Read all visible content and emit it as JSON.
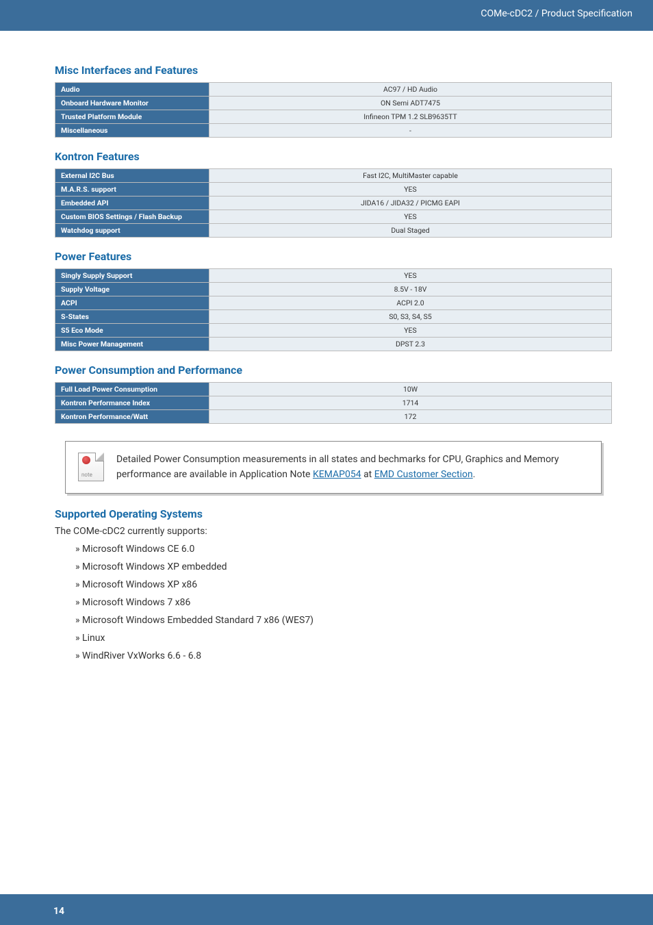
{
  "header": {
    "doc_title": "COMe-cDC2 / Product Specification"
  },
  "sections": {
    "misc": {
      "title": "Misc Interfaces and Features",
      "rows": [
        {
          "label": "Audio",
          "value": "AC97 / HD Audio"
        },
        {
          "label": "Onboard Hardware Monitor",
          "value": "ON Semi ADT7475"
        },
        {
          "label": "Trusted Platform Module",
          "value": "Infineon TPM 1.2 SLB9635TT"
        },
        {
          "label": "Miscellaneous",
          "value": "-"
        }
      ]
    },
    "kontron": {
      "title": "Kontron Features",
      "rows": [
        {
          "label": "External I2C Bus",
          "value": "Fast I2C, MultiMaster capable"
        },
        {
          "label": "M.A.R.S. support",
          "value": "YES"
        },
        {
          "label": "Embedded API",
          "value": "JIDA16 / JIDA32 / PICMG EAPI"
        },
        {
          "label": "Custom BIOS Settings / Flash Backup",
          "value": "YES"
        },
        {
          "label": "Watchdog support",
          "value": "Dual Staged"
        }
      ]
    },
    "power_features": {
      "title": "Power Features",
      "rows": [
        {
          "label": "Singly Supply Support",
          "value": "YES"
        },
        {
          "label": "Supply Voltage",
          "value": "8.5V - 18V"
        },
        {
          "label": "ACPI",
          "value": "ACPI 2.0"
        },
        {
          "label": "S-States",
          "value": "S0, S3, S4, S5"
        },
        {
          "label": "S5 Eco Mode",
          "value": "YES"
        },
        {
          "label": "Misc Power Management",
          "value": "DPST 2.3"
        }
      ]
    },
    "power_consumption": {
      "title": "Power Consumption and Performance",
      "rows": [
        {
          "label": "Full Load Power Consumption",
          "value": "10W"
        },
        {
          "label": "Kontron Performance Index",
          "value": "1714"
        },
        {
          "label": "Kontron Performance/Watt",
          "value": "172"
        }
      ]
    },
    "supported_os": {
      "title": "Supported Operating Systems",
      "intro": "The COMe-cDC2 currently supports:",
      "items": [
        "Microsoft Windows CE 6.0",
        "Microsoft Windows XP embedded",
        "Microsoft Windows XP x86",
        "Microsoft Windows 7 x86",
        "Microsoft Windows Embedded Standard 7 x86 (WES7)",
        "Linux",
        "WindRiver VxWorks 6.6 - 6.8"
      ]
    }
  },
  "note": {
    "icon_label": "note",
    "text_pre": "Detailed Power Consumption measurements in all states and bechmarks for CPU, Graphics and Memory performance are available in Application Note ",
    "link1": "KEMAP054",
    "text_mid": " at ",
    "link2": "EMD Customer Section",
    "text_post": "."
  },
  "footer": {
    "page": "14"
  }
}
